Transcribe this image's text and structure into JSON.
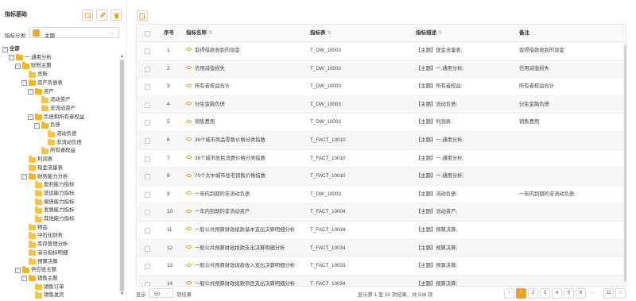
{
  "left_panel": {
    "title": "指标基础",
    "category_label": "指标分类:",
    "category_value": "主题",
    "tree": [
      {
        "label": "全部",
        "level": 0,
        "toggle": "minus",
        "folder": false,
        "bold": true
      },
      {
        "label": "一.通用分析",
        "level": 1,
        "toggle": "minus",
        "folder": true
      },
      {
        "label": "财税主题",
        "level": 2,
        "toggle": "minus",
        "folder": true
      },
      {
        "label": "总账",
        "level": 3,
        "toggle": "none",
        "folder": true
      },
      {
        "label": "资产负债表",
        "level": 3,
        "toggle": "minus",
        "folder": true
      },
      {
        "label": "资产",
        "level": 4,
        "toggle": "minus",
        "folder": true
      },
      {
        "label": "流动资产",
        "level": 5,
        "toggle": "none",
        "folder": true
      },
      {
        "label": "非流动资产",
        "level": 5,
        "toggle": "none",
        "folder": true
      },
      {
        "label": "负债和所有者权益",
        "level": 4,
        "toggle": "minus",
        "folder": true
      },
      {
        "label": "负债",
        "level": 5,
        "toggle": "minus",
        "folder": true
      },
      {
        "label": "流动负债",
        "level": 6,
        "toggle": "none",
        "folder": true
      },
      {
        "label": "非流动负债",
        "level": 6,
        "toggle": "none",
        "folder": true
      },
      {
        "label": "所有者权益",
        "level": 5,
        "toggle": "none",
        "folder": true
      },
      {
        "label": "利润表",
        "level": 3,
        "toggle": "none",
        "folder": true
      },
      {
        "label": "现金流量表",
        "level": 3,
        "toggle": "none",
        "folder": true
      },
      {
        "label": "财务能力分析",
        "level": 3,
        "toggle": "minus",
        "folder": true
      },
      {
        "label": "盈利能力指标",
        "level": 4,
        "toggle": "none",
        "folder": true
      },
      {
        "label": "营运能力指标",
        "level": 4,
        "toggle": "none",
        "folder": true
      },
      {
        "label": "偿债能力指标",
        "level": 4,
        "toggle": "none",
        "folder": true
      },
      {
        "label": "发展能力指标",
        "level": 4,
        "toggle": "none",
        "folder": true
      },
      {
        "label": "其他能力指标",
        "level": 4,
        "toggle": "none",
        "folder": true
      },
      {
        "label": "物品",
        "level": 3,
        "toggle": "none",
        "folder": true
      },
      {
        "label": "中石化财务",
        "level": 3,
        "toggle": "none",
        "folder": true
      },
      {
        "label": "库存管理分析",
        "level": 3,
        "toggle": "none",
        "folder": true
      },
      {
        "label": "演示指标明细",
        "level": 3,
        "toggle": "none",
        "folder": true
      },
      {
        "label": "预算决算",
        "level": 3,
        "toggle": "none",
        "folder": true
      },
      {
        "label": "供应链主题",
        "level": 2,
        "toggle": "minus",
        "folder": true
      },
      {
        "label": "销售主题",
        "level": 3,
        "toggle": "minus",
        "folder": true
      },
      {
        "label": "销售订单",
        "level": 4,
        "toggle": "none",
        "folder": true
      },
      {
        "label": "销售发货",
        "level": 4,
        "toggle": "none",
        "folder": true
      }
    ]
  },
  "table": {
    "columns": [
      "序号",
      "指标名称",
      "指标表",
      "指标描述",
      "备注"
    ],
    "rows": [
      {
        "no": "1",
        "name": "取得借款收到的现金",
        "table": "T_DW_10003",
        "desc": "【主题】现金流量表;",
        "note": "取得借款收到的现金"
      },
      {
        "no": "2",
        "name": "信用减值损失",
        "table": "T_DW_10003",
        "desc": "【主题】一.通用分析;",
        "note": "信用减值损失"
      },
      {
        "no": "3",
        "name": "所有者权益合计",
        "table": "T_DW_10003",
        "desc": "【主题】所有者权益;",
        "note": "所有者权益合计"
      },
      {
        "no": "4",
        "name": "衍生金融负债",
        "table": "T_DW_10003",
        "desc": "【主题】流动负债;",
        "note": "衍生金融负债"
      },
      {
        "no": "5",
        "name": "销售费用",
        "table": "T_DW_10003",
        "desc": "【主题】利润表;",
        "note": "销售费用"
      },
      {
        "no": "6",
        "name": "36个城市商品零售价格分类指数",
        "table": "T_FACT_10010",
        "desc": "【主题】一.通用分析;",
        "note": ""
      },
      {
        "no": "7",
        "name": "36个城市居民消费价格分类指数",
        "table": "T_FACT_10010",
        "desc": "【主题】一.通用分析;",
        "note": ""
      },
      {
        "no": "8",
        "name": "70个大中城市住宅销售价格指数",
        "table": "T_FACT_10010",
        "desc": "【主题】一.通用分析;",
        "note": ""
      },
      {
        "no": "9",
        "name": "一年内到期的非流动负债",
        "table": "T_DW_10003",
        "desc": "【主题】流动负债;",
        "note": "一年内到期的非流动负债"
      },
      {
        "no": "10",
        "name": "一年内到期的非流动资产",
        "table": "T_FACT_10004",
        "desc": "【主题】流动资产;",
        "note": ""
      },
      {
        "no": "11",
        "name": "一般公共预算财政拨款基本支出决算明细分析",
        "table": "T_FACT_10034",
        "desc": "【主题】预算决算;",
        "note": ""
      },
      {
        "no": "12",
        "name": "一般公共预算财政拨款支出决算明细分析",
        "table": "T_FACT_10034",
        "desc": "【主题】预算决算;",
        "note": ""
      },
      {
        "no": "13",
        "name": "一般公共预算财政拨款收入支出决算明细分析",
        "table": "T_FACT_10033",
        "desc": "【主题】预算决算;",
        "note": ""
      },
      {
        "no": "14",
        "name": "一般公共预算财政拨款项目支出决算明细分析",
        "table": "T_FACT_10034",
        "desc": "【主题】预算决算;",
        "note": ""
      }
    ]
  },
  "footer": {
    "page_size_label": "显示",
    "page_size_value": "50",
    "page_size_unit": "项结果",
    "info": "显示第 1 至 50 项结果，共 536 项",
    "pages": [
      "1",
      "2",
      "3",
      "4",
      "5",
      "6"
    ],
    "ellipsis": "...",
    "last_page": "11",
    "prev": "‹",
    "next": "›",
    "active_page": "1"
  },
  "colors": {
    "accent": "#f0a020",
    "folder": "#f6c344"
  }
}
